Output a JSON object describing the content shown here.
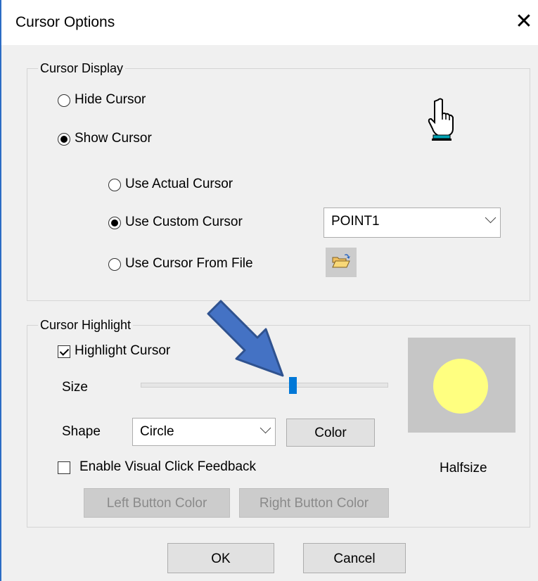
{
  "window": {
    "title": "Cursor Options",
    "close_glyph": "✕"
  },
  "cursor_display": {
    "legend": "Cursor Display",
    "hide_label": "Hide Cursor",
    "show_label": "Show Cursor",
    "actual_label": "Use Actual Cursor",
    "custom_label": "Use Custom Cursor",
    "file_label": "Use Cursor From File",
    "custom_selected": "POINT1",
    "selected_mode": "Show Cursor",
    "selected_source": "Use Custom Cursor",
    "icons": {
      "preview": "pointing-hand-icon",
      "browse": "open-folder-icon"
    }
  },
  "cursor_highlight": {
    "legend": "Cursor Highlight",
    "highlight_label": "Highlight Cursor",
    "highlight_checked": true,
    "size_label": "Size",
    "size_value_fraction": 0.6,
    "shape_label": "Shape",
    "shape_selected": "Circle",
    "color_button": "Color",
    "visual_feedback_label": "Enable Visual Click Feedback",
    "visual_feedback_checked": false,
    "left_button_color": "Left Button Color",
    "right_button_color": "Right Button Color",
    "preview_caption": "Halfsize",
    "preview_color": "#ffff80"
  },
  "footer": {
    "ok": "OK",
    "cancel": "Cancel"
  },
  "annotation": {
    "icon": "blue-arrow-icon",
    "color": "#4472c4"
  }
}
